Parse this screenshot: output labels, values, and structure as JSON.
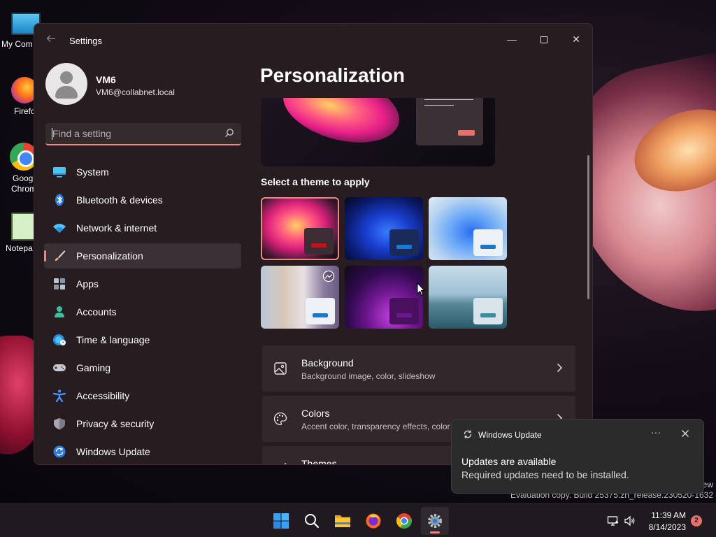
{
  "desktop": {
    "icons": [
      {
        "label": "My Com",
        "icon": "computer-icon"
      },
      {
        "label": "Firefo",
        "icon": "firefox-icon"
      },
      {
        "label": "Goog",
        "label2": "Chrom",
        "icon": "chrome-icon"
      },
      {
        "label": "Notepa",
        "icon": "notepad-icon"
      }
    ]
  },
  "window": {
    "title": "Settings",
    "controls": {
      "minimize": "—",
      "close": "✕"
    }
  },
  "profile": {
    "name": "VM6",
    "email": "VM6@collabnet.local"
  },
  "search": {
    "placeholder": "Find a setting"
  },
  "nav": {
    "items": [
      {
        "label": "System",
        "icon": "system-icon",
        "color": "#4cc2ff"
      },
      {
        "label": "Bluetooth & devices",
        "icon": "bluetooth-icon",
        "color": "#4c9aff"
      },
      {
        "label": "Network & internet",
        "icon": "wifi-icon",
        "color": "#4cc2ff"
      },
      {
        "label": "Personalization",
        "icon": "brush-icon",
        "color": "#f0a868",
        "active": true
      },
      {
        "label": "Apps",
        "icon": "apps-icon",
        "color": "#9aa8b8"
      },
      {
        "label": "Accounts",
        "icon": "accounts-icon",
        "color": "#3ac0a0"
      },
      {
        "label": "Time & language",
        "icon": "globe-clock-icon",
        "color": "#4cc2ff"
      },
      {
        "label": "Gaming",
        "icon": "gamepad-icon",
        "color": "#b8b8c8"
      },
      {
        "label": "Accessibility",
        "icon": "accessibility-icon",
        "color": "#4c9aff"
      },
      {
        "label": "Privacy & security",
        "icon": "shield-icon",
        "color": "#9a9aa8"
      },
      {
        "label": "Windows Update",
        "icon": "update-icon",
        "color": "#4c9aff"
      }
    ]
  },
  "content": {
    "title": "Personalization",
    "theme_section_label": "Select a theme to apply",
    "cards": [
      {
        "title": "Background",
        "subtitle": "Background image, color, slideshow",
        "icon": "image-icon"
      },
      {
        "title": "Colors",
        "subtitle": "Accent color, transparency effects, color",
        "icon": "palette-icon"
      },
      {
        "title": "Themes",
        "subtitle": "",
        "icon": "brush-icon"
      }
    ]
  },
  "notification": {
    "app": "Windows Update",
    "title": "Updates are available",
    "body": "Required updates need to be installed.",
    "more": "···"
  },
  "watermark": {
    "line1": "ew",
    "line2": "Evaluation copy. Build 25375.zn_release.230520-1632"
  },
  "taskbar": {
    "time": "11:39 AM",
    "date": "8/14/2023",
    "badge": "2",
    "accent": "#e88880"
  }
}
